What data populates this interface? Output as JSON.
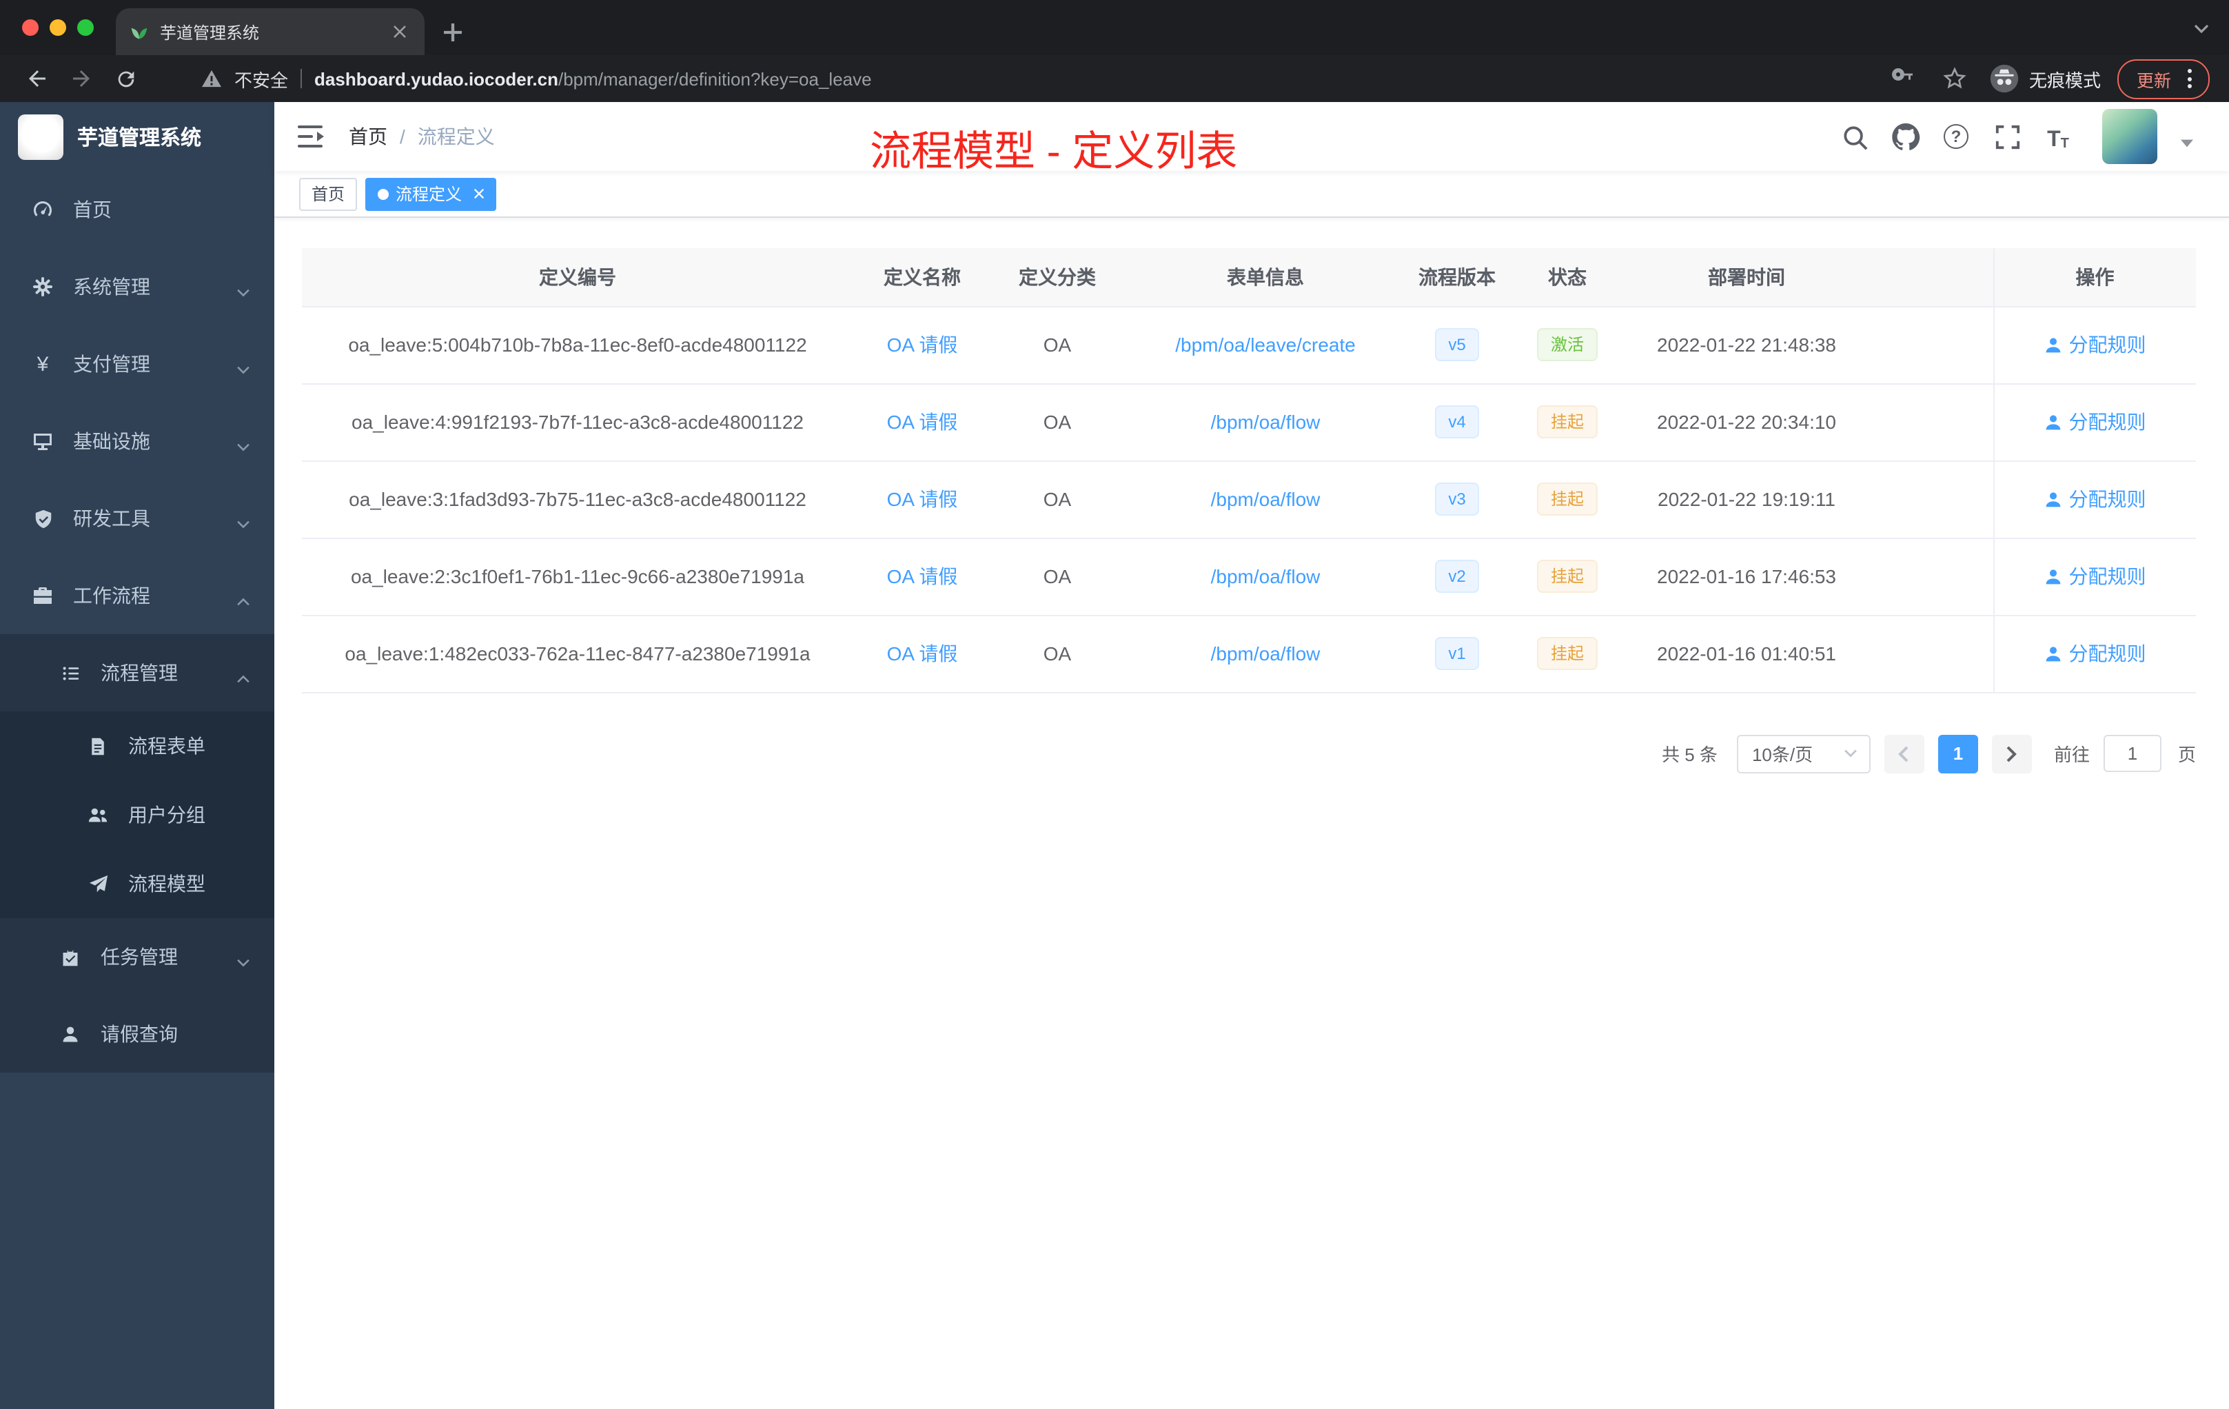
{
  "colors": {
    "primary": "#409eff",
    "success": "#67c23a",
    "warning": "#e6a23c",
    "annotation_red": "#f5261d",
    "sidebar_bg": "#304156",
    "sidebar_submenu_bg": "#1f2d3d"
  },
  "browser": {
    "tab_title": "芋道管理系统",
    "security_label": "不安全",
    "url_host": "dashboard.yudao.iocoder.cn",
    "url_path": "/bpm/manager/definition?key=oa_leave",
    "incognito_label": "无痕模式",
    "update_label": "更新"
  },
  "sidebar": {
    "logo_title": "芋道管理系统",
    "items": [
      {
        "label": "首页",
        "icon": "dashboard-icon",
        "level": 1
      },
      {
        "label": "系统管理",
        "icon": "gear-icon",
        "level": 1,
        "expandable": true
      },
      {
        "label": "支付管理",
        "icon": "yen-icon",
        "level": 1,
        "expandable": true
      },
      {
        "label": "基础设施",
        "icon": "monitor-icon",
        "level": 1,
        "expandable": true
      },
      {
        "label": "研发工具",
        "icon": "shield-icon",
        "level": 1,
        "expandable": true
      },
      {
        "label": "工作流程",
        "icon": "briefcase-icon",
        "level": 1,
        "expandable": true,
        "expanded": true
      },
      {
        "label": "流程管理",
        "icon": "list-icon",
        "level": 2,
        "expandable": true,
        "expanded": true
      },
      {
        "label": "流程表单",
        "icon": "form-icon",
        "level": 3
      },
      {
        "label": "用户分组",
        "icon": "user-group-icon",
        "level": 3
      },
      {
        "label": "流程模型",
        "icon": "send-icon",
        "level": 3
      },
      {
        "label": "任务管理",
        "icon": "clipboard-icon",
        "level": 2,
        "expandable": true
      },
      {
        "label": "请假查询",
        "icon": "user-icon",
        "level": 2
      }
    ]
  },
  "header": {
    "breadcrumb": {
      "home": "首页",
      "separator": "/",
      "current": "流程定义"
    },
    "annotation": "流程模型 - 定义列表"
  },
  "tags": {
    "items": [
      {
        "label": "首页",
        "active": false
      },
      {
        "label": "流程定义",
        "active": true,
        "closable": true
      }
    ]
  },
  "table": {
    "columns": [
      "定义编号",
      "定义名称",
      "定义分类",
      "表单信息",
      "流程版本",
      "状态",
      "部署时间",
      "操作"
    ],
    "rows": [
      {
        "id": "oa_leave:5:004b710b-7b8a-11ec-8ef0-acde48001122",
        "name": "OA 请假",
        "category": "OA",
        "form": "/bpm/oa/leave/create",
        "version": "v5",
        "status": "激活",
        "deploy_time": "2022-01-22 21:48:38",
        "action": "分配规则"
      },
      {
        "id": "oa_leave:4:991f2193-7b7f-11ec-a3c8-acde48001122",
        "name": "OA 请假",
        "category": "OA",
        "form": "/bpm/oa/flow",
        "version": "v4",
        "status": "挂起",
        "deploy_time": "2022-01-22 20:34:10",
        "action": "分配规则"
      },
      {
        "id": "oa_leave:3:1fad3d93-7b75-11ec-a3c8-acde48001122",
        "name": "OA 请假",
        "category": "OA",
        "form": "/bpm/oa/flow",
        "version": "v3",
        "status": "挂起",
        "deploy_time": "2022-01-22 19:19:11",
        "action": "分配规则"
      },
      {
        "id": "oa_leave:2:3c1f0ef1-76b1-11ec-9c66-a2380e71991a",
        "name": "OA 请假",
        "category": "OA",
        "form": "/bpm/oa/flow",
        "version": "v2",
        "status": "挂起",
        "deploy_time": "2022-01-16 17:46:53",
        "action": "分配规则"
      },
      {
        "id": "oa_leave:1:482ec033-762a-11ec-8477-a2380e71991a",
        "name": "OA 请假",
        "category": "OA",
        "form": "/bpm/oa/flow",
        "version": "v1",
        "status": "挂起",
        "deploy_time": "2022-01-16 01:40:51",
        "action": "分配规则"
      }
    ]
  },
  "pagination": {
    "total_label": "共 5 条",
    "page_size_label": "10条/页",
    "current_page": "1",
    "goto_label": "前往",
    "goto_value": "1",
    "unit_label": "页"
  }
}
